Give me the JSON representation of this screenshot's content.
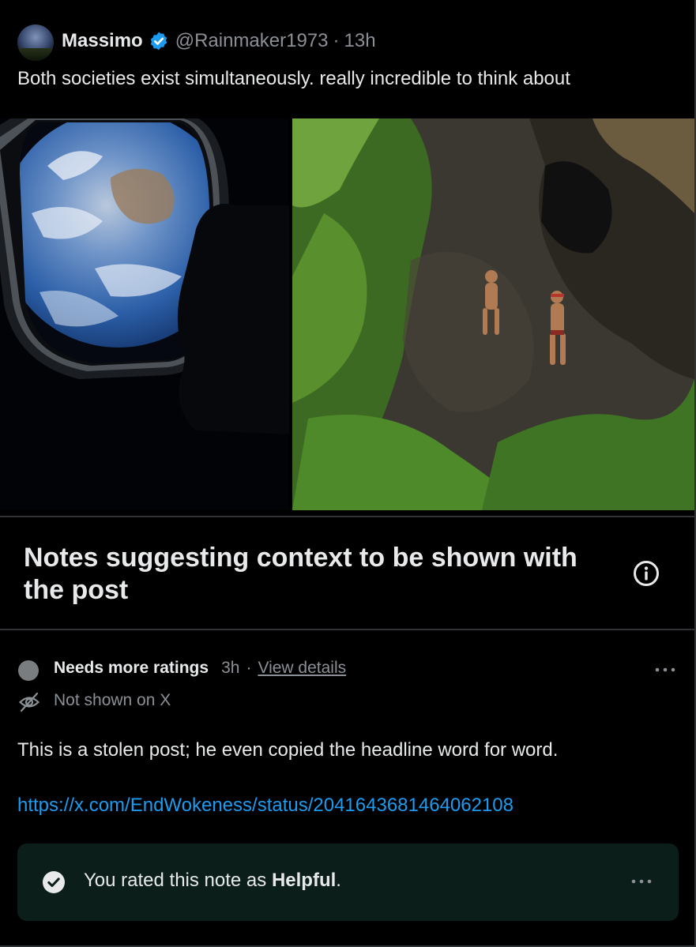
{
  "post": {
    "author_name": "Massimo",
    "handle": "@Rainmaker1973",
    "separator": "·",
    "time": "13h",
    "text": "Both societies exist simultaneously. really incredible to think about",
    "images": [
      {
        "icon": "earth-window-photo"
      },
      {
        "icon": "jungle-tribe-photo"
      }
    ]
  },
  "notes": {
    "title": "Notes suggesting context to be shown with the post",
    "note": {
      "status": "Needs more ratings",
      "time": "3h",
      "separator": "·",
      "view_details": "View details",
      "visibility": "Not shown on X",
      "text": "This is a stolen post; he even copied the headline word for word.",
      "link": "https://x.com/EndWokeness/status/2041643681464062108"
    },
    "rating": {
      "prefix": "You rated this note as ",
      "value": "Helpful",
      "suffix": "."
    }
  },
  "colors": {
    "background": "#000000",
    "text": "#e7e9ea",
    "muted": "#8b9096",
    "link": "#1d9bf0",
    "verified": "#1d9bf0",
    "rating_box": "#0c1e19"
  }
}
